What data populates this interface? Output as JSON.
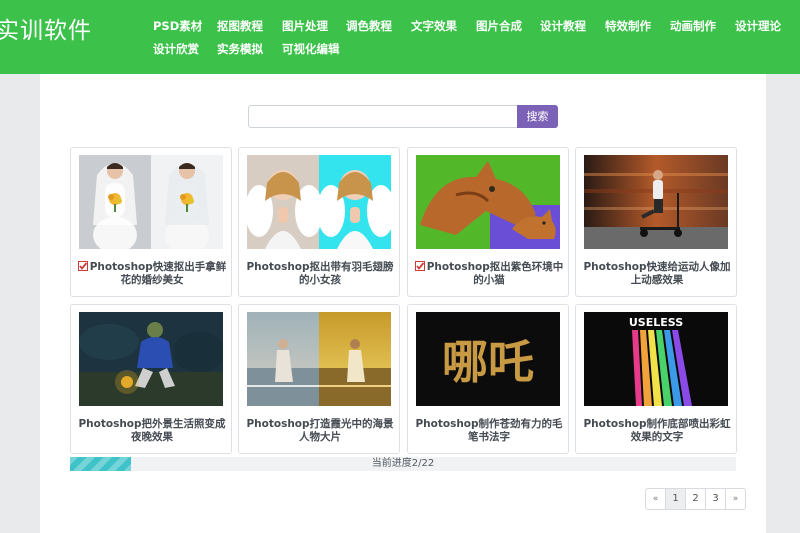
{
  "header": {
    "logo_text": "实训软件",
    "colors": {
      "header_bg": "#3cc24a",
      "search_button": "#7b62b6",
      "progress_fill": "#3fc3c9"
    },
    "nav": [
      "PSD素材",
      "抠图教程",
      "图片处理",
      "调色教程",
      "文字效果",
      "图片合成",
      "设计教程",
      "特效制作",
      "动画制作",
      "设计理论",
      "设计欣赏",
      "实务模拟",
      "可视化编辑"
    ]
  },
  "search": {
    "value": "",
    "placeholder": "",
    "button_label": "搜索"
  },
  "cards": [
    {
      "title": "Photoshop快速抠出手拿鲜花的婚纱美女",
      "checked": true,
      "icon": "check-icon"
    },
    {
      "title": "Photoshop抠出带有羽毛翅膀的小女孩",
      "checked": false
    },
    {
      "title": "Photoshop抠出紫色环境中的小猫",
      "checked": true,
      "icon": "check-icon"
    },
    {
      "title": "Photoshop快速给运动人像加上动感效果",
      "checked": false
    },
    {
      "title": "Photoshop把外景生活照变成夜晚效果",
      "checked": false
    },
    {
      "title": "Photoshop打造霞光中的海景人物大片",
      "checked": false
    },
    {
      "title": "Photoshop制作苍劲有力的毛笔书法字",
      "checked": false
    },
    {
      "title": "Photoshop制作底部喷出彩虹效果的文字",
      "checked": false
    }
  ],
  "thumb_text": {
    "calligraphy": "哪吒",
    "useless": "USELESS"
  },
  "progress": {
    "label": "当前进度2/22",
    "current": 2,
    "total": 22
  },
  "pagination": {
    "prev": "«",
    "pages": [
      "1",
      "2",
      "3"
    ],
    "active": 0,
    "next": "»"
  }
}
